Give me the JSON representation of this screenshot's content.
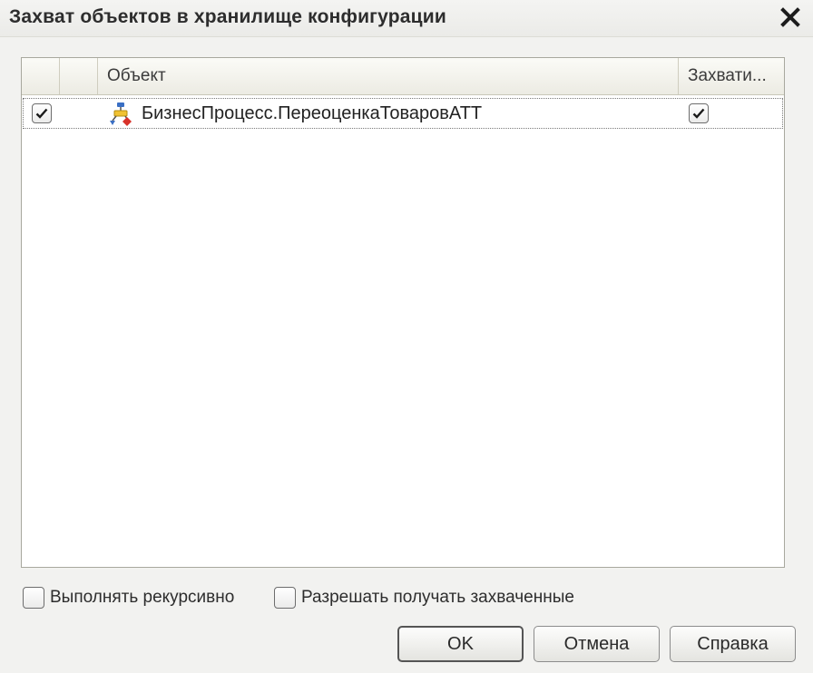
{
  "window": {
    "title": "Захват объектов в хранилище конфигурации"
  },
  "table": {
    "columns": [
      "",
      "",
      "Объект",
      "Захвати..."
    ],
    "rows": [
      {
        "checked": true,
        "icon": "business-process-icon",
        "object": "БизнесПроцесс.ПереоценкаТоваровАТТ",
        "capture": true
      }
    ]
  },
  "options": {
    "recursive": {
      "label": "Выполнять рекурсивно",
      "checked": false
    },
    "allow_captured": {
      "label": "Разрешать получать захваченные",
      "checked": false
    }
  },
  "buttons": {
    "ok": "OK",
    "cancel": "Отмена",
    "help": "Справка"
  },
  "colors": {
    "accent_red": "#d8322a",
    "accent_blue": "#3a6fc4",
    "accent_yellow": "#f1c232"
  }
}
